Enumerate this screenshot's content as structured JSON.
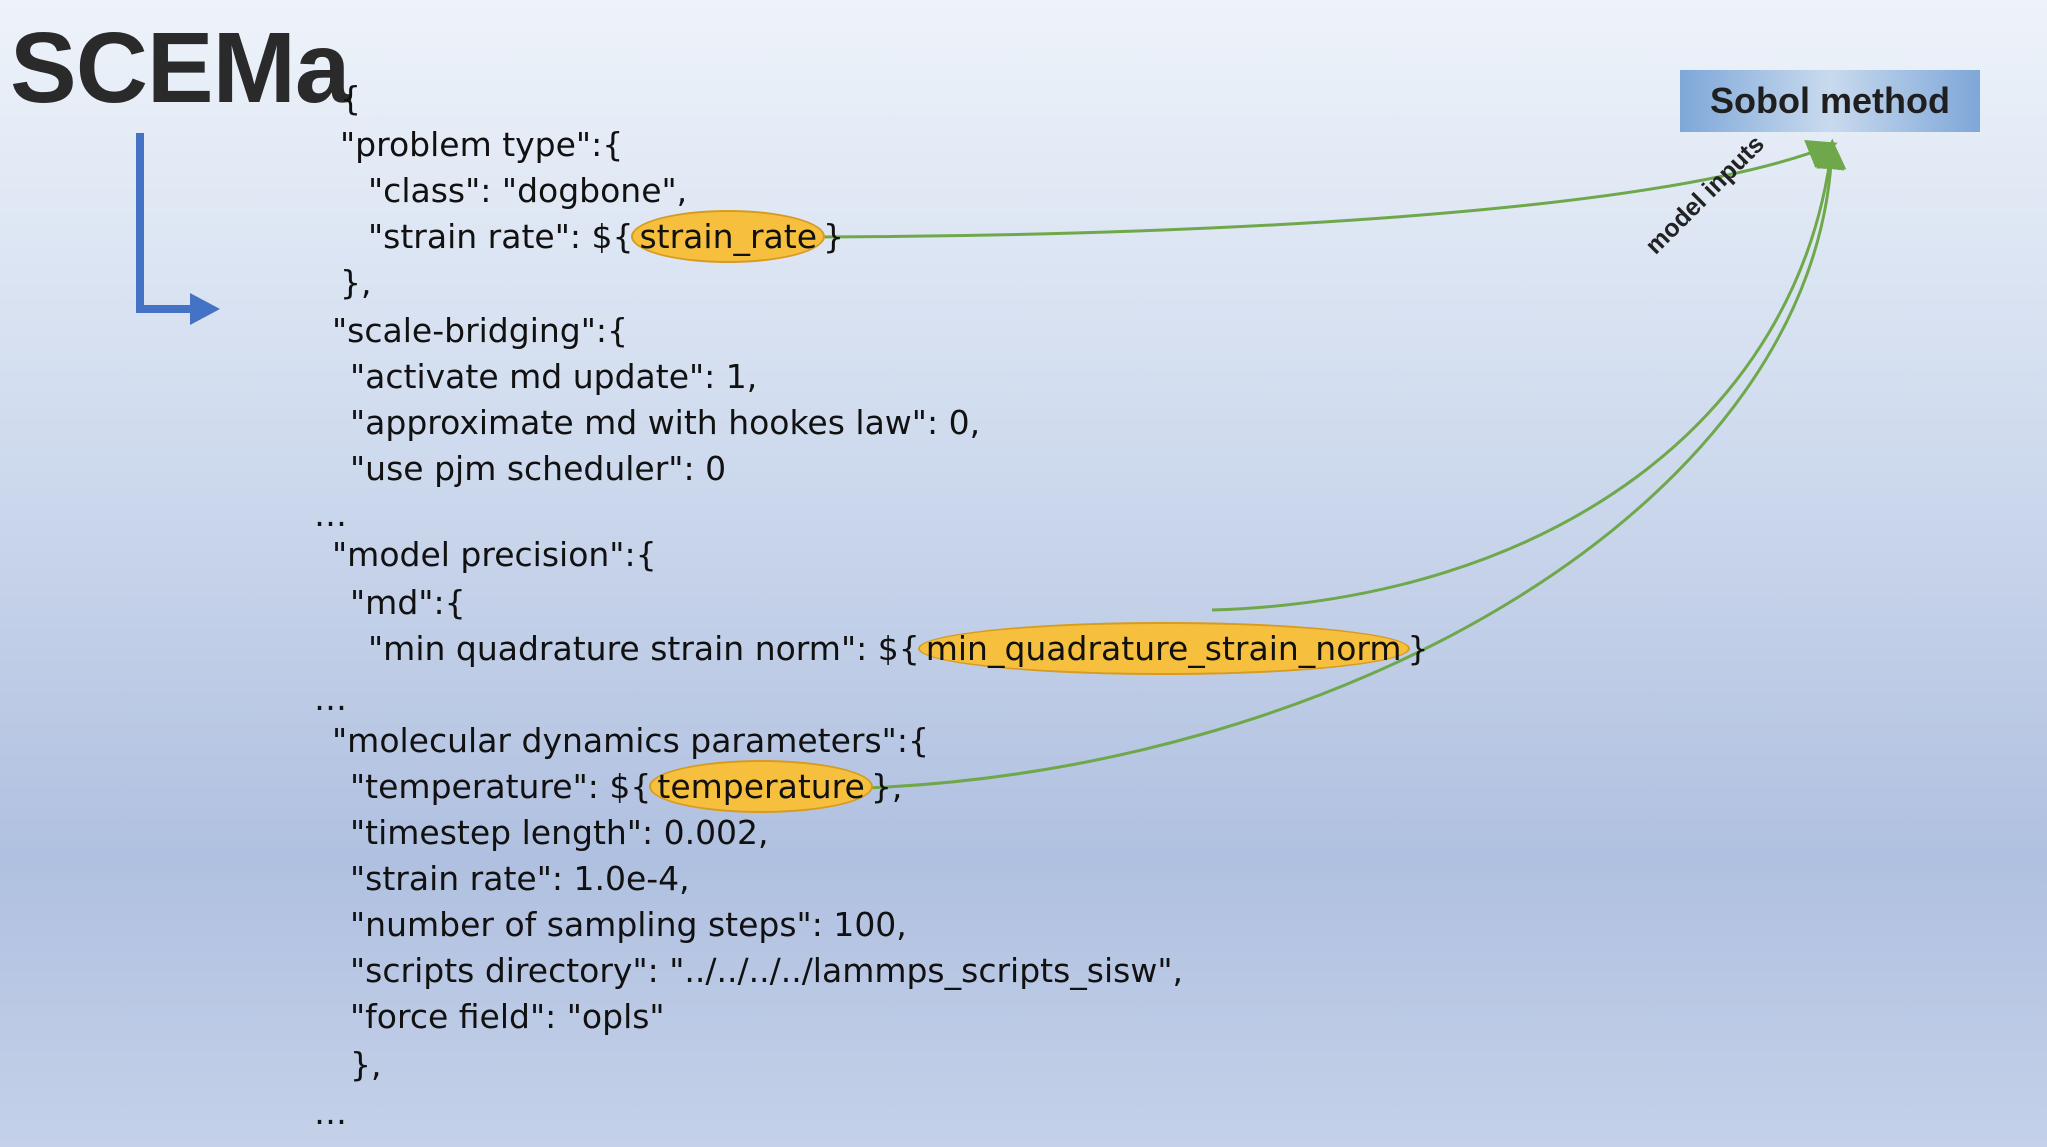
{
  "title": "SCEMa",
  "sobol_box": "Sobol method",
  "arrow_label": "model inputs",
  "colors": {
    "highlight": "#f6c03e",
    "arrow_green": "#6ea84a",
    "arrow_blue": "#4472c4"
  },
  "code": {
    "l01": "{",
    "l02": "\"problem type\":{",
    "l03": "\"class\": \"dogbone\",",
    "l04_pre": "\"strain rate\": ${",
    "l04_var": "strain_rate",
    "l04_post": "}",
    "l05": "},",
    "l06": "\"scale-bridging\":{",
    "l07": "\"activate md update\": 1,",
    "l08": "\"approximate md with hookes law\": 0,",
    "l09": "\"use pjm scheduler\": 0",
    "l10": "…",
    "l11": "\"model precision\":{",
    "l12": "\"md\":{",
    "l13_pre": "\"min quadrature strain norm\": ${",
    "l13_var": "min_quadrature_strain_norm",
    "l13_post": "}",
    "l14": "…",
    "l15": "\"molecular dynamics parameters\":{",
    "l16_pre": "\"temperature\": ${",
    "l16_var": "temperature",
    "l16_post": "},",
    "l17": "\"timestep length\": 0.002,",
    "l18": "\"strain rate\": 1.0e-4,",
    "l19": "\"number of sampling steps\": 100,",
    "l20": "\"scripts directory\": \"../../../../lammps_scripts_sisw\",",
    "l21": "\"force field\": \"opls\"",
    "l22": "},",
    "l23": "…"
  }
}
